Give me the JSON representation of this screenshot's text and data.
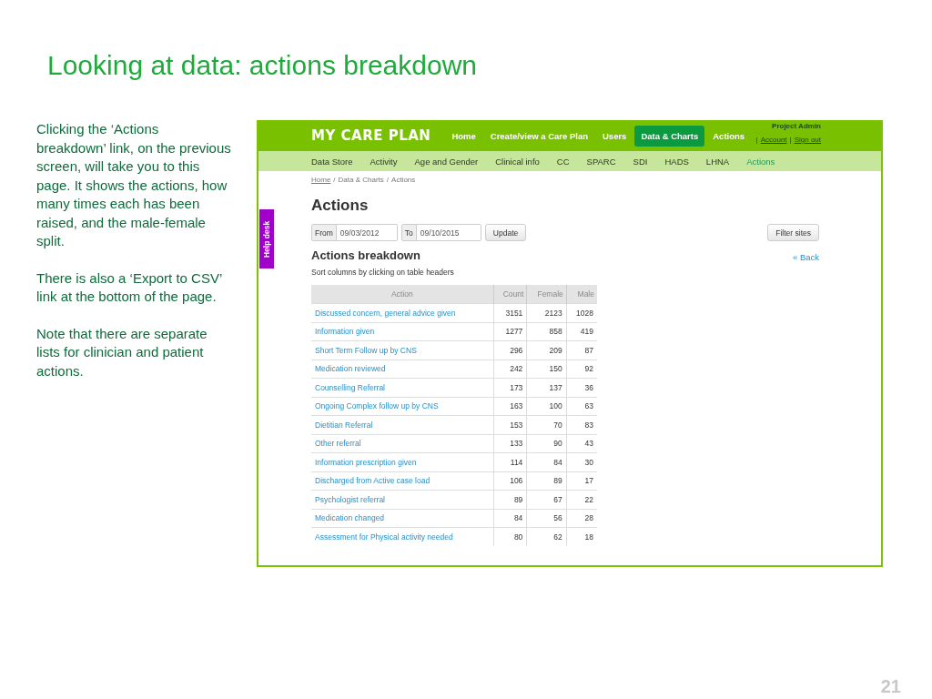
{
  "slide": {
    "title": "Looking at data: actions breakdown",
    "paragraphs": [
      "Clicking the ‘Actions breakdown’ link, on the previous screen, will take you to this page. It shows the actions, how many times each has been raised, and the male-female split.",
      "There is also a ‘Export to CSV’ link at the bottom of the page.",
      "Note that there are separate lists for clinician and patient actions."
    ],
    "page_number": "21"
  },
  "screen": {
    "logo": "MY CARE PLAN",
    "nav": [
      {
        "label": "Home",
        "selected": false
      },
      {
        "label": "Create/view a Care Plan",
        "selected": false
      },
      {
        "label": "Users",
        "selected": false
      },
      {
        "label": "Data & Charts",
        "selected": true
      },
      {
        "label": "Actions",
        "selected": false
      }
    ],
    "user": {
      "name": "Project Admin",
      "separator": "|",
      "links": [
        "Account",
        "Sign out"
      ]
    },
    "subnav": [
      {
        "label": "Data Store",
        "selected": false
      },
      {
        "label": "Activity",
        "selected": false
      },
      {
        "label": "Age and Gender",
        "selected": false
      },
      {
        "label": "Clinical info",
        "selected": false
      },
      {
        "label": "CC",
        "selected": false
      },
      {
        "label": "SPARC",
        "selected": false
      },
      {
        "label": "SDI",
        "selected": false
      },
      {
        "label": "HADS",
        "selected": false
      },
      {
        "label": "LHNA",
        "selected": false
      },
      {
        "label": "Actions",
        "selected": true
      }
    ],
    "help_tab": "Help desk",
    "breadcrumb": [
      "Home",
      "Data & Charts",
      "Actions"
    ],
    "breadcrumb_separator": "/",
    "heading": "Actions",
    "from": {
      "label": "From",
      "value": "09/03/2012"
    },
    "to": {
      "label": "To",
      "value": "09/10/2015"
    },
    "update_button": "Update",
    "filter_button": "Filter sites",
    "subheading": "Actions breakdown",
    "back_link": "« Back",
    "hint": "Sort columns by clicking on table headers",
    "table": {
      "columns": [
        "Action",
        "Count",
        "Female",
        "Male"
      ],
      "rows": [
        [
          "Discussed concern, general advice given",
          "3151",
          "2123",
          "1028"
        ],
        [
          "Information given",
          "1277",
          "858",
          "419"
        ],
        [
          "Short Term Follow up by CNS",
          "296",
          "209",
          "87"
        ],
        [
          "Medication reviewed",
          "242",
          "150",
          "92"
        ],
        [
          "Counselling Referral",
          "173",
          "137",
          "36"
        ],
        [
          "Ongoing Complex follow up by CNS",
          "163",
          "100",
          "63"
        ],
        [
          "Dietitian Referral",
          "153",
          "70",
          "83"
        ],
        [
          "Other referral",
          "133",
          "90",
          "43"
        ],
        [
          "Information prescription given",
          "114",
          "84",
          "30"
        ],
        [
          "Discharged from Active case load",
          "106",
          "89",
          "17"
        ],
        [
          "Psychologist referral",
          "89",
          "67",
          "22"
        ],
        [
          "Medication changed",
          "84",
          "56",
          "28"
        ],
        [
          "Assessment for Physical activity needed",
          "80",
          "62",
          "18"
        ]
      ]
    }
  }
}
